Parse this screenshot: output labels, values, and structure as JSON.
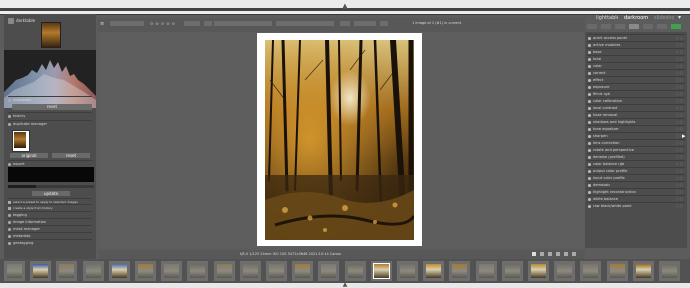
{
  "app": {
    "name": "darktable"
  },
  "left": {
    "rows": [
      "snapshots",
      "history",
      "duplicate manager",
      "export",
      "tagging",
      "image information",
      "mask manager",
      "metadata",
      "geotagging"
    ],
    "compress_button": "compress history stack",
    "apply_button": "reset",
    "thumb_buttons": [
      "original",
      "reset"
    ],
    "update_button": "update",
    "checkbox_a": "select a preset to apply to selected images",
    "checkbox_b": "create a style from history"
  },
  "toolbar": {
    "stars": "✩ ✩ ✩ ✩ ✩",
    "info": "1 image of 1 (#1) in current collection is selected"
  },
  "tabs": [
    "lighttable",
    "darkroom",
    "slideshow"
  ],
  "right_modules": [
    "quick access panel",
    "active modules",
    "base",
    "tone",
    "color",
    "correct",
    "effect",
    "exposure",
    "filmic rgb",
    "color calibration",
    "local contrast",
    "haze removal",
    "shadows and highlights",
    "tone equalizer",
    "sharpen",
    "lens correction",
    "rotate and perspective",
    "denoise (profiled)",
    "color balance rgb",
    "output color profile",
    "input color profile",
    "demosaic",
    "highlight reconstruction",
    "white balance",
    "raw black/white point"
  ],
  "status": {
    "text": "f/8.0  1/125  24mm  ISO 100  5472x3648  2021:10:14  Canon"
  },
  "filmstrip_count": 26,
  "colors": {
    "panel": "#4d4d4d",
    "bg": "#5e5e5e",
    "accent": "#e8b04a"
  }
}
